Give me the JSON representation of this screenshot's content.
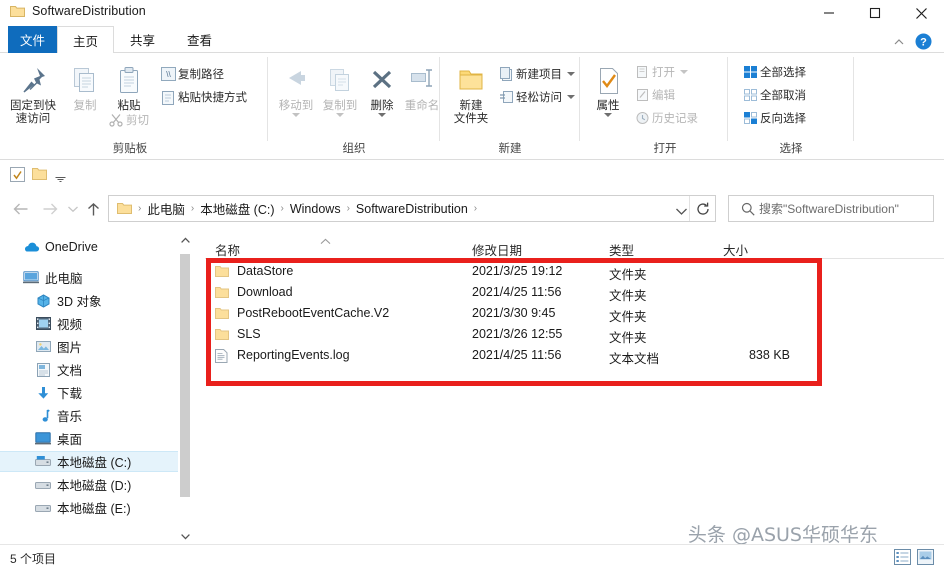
{
  "window": {
    "title": "SoftwareDistribution",
    "folder_icon": "folder-icon",
    "minimize_label": "—",
    "maximize_label": "□",
    "close_label": "✕"
  },
  "ribbon": {
    "tabs": [
      {
        "label": "文件",
        "name": "tab-file",
        "state": "file-menu"
      },
      {
        "label": "主页",
        "name": "tab-home",
        "state": "active"
      },
      {
        "label": "共享",
        "name": "tab-share",
        "state": "normal"
      },
      {
        "label": "查看",
        "name": "tab-view",
        "state": "normal"
      }
    ],
    "help_icon": "help-icon",
    "collapse_icon": "chevron-up-icon",
    "groups": [
      {
        "name": "clipboard",
        "title": "剪贴板",
        "big_buttons": [
          {
            "label_line1": "固定到快",
            "label_line2": "速访问",
            "icon": "pin-icon",
            "disabled": false
          },
          {
            "label_line1": "复制",
            "label_line2": "",
            "icon": "copy-icon",
            "disabled": true
          },
          {
            "label_line1": "粘贴",
            "label_line2": "",
            "icon": "paste-icon",
            "disabled": false
          }
        ],
        "small_buttons": [
          {
            "label": "复制路径",
            "icon": "copy-path-icon",
            "disabled": false
          },
          {
            "label": "粘贴快捷方式",
            "icon": "paste-shortcut-icon",
            "disabled": false
          },
          {
            "label": "剪切",
            "icon": "scissors-icon",
            "disabled": true
          }
        ]
      },
      {
        "name": "organize",
        "title": "组织",
        "big_buttons": [
          {
            "label_line1": "移动到",
            "label_line2": "",
            "icon": "move-to-icon",
            "disabled": true
          },
          {
            "label_line1": "复制到",
            "label_line2": "",
            "icon": "copy-to-icon",
            "disabled": true
          },
          {
            "label_line1": "删除",
            "label_line2": "",
            "icon": "delete-x-icon",
            "disabled": false
          },
          {
            "label_line1": "重命名",
            "label_line2": "",
            "icon": "rename-icon",
            "disabled": true
          }
        ],
        "small_buttons": []
      },
      {
        "name": "new",
        "title": "新建",
        "big_buttons": [
          {
            "label_line1": "新建",
            "label_line2": "文件夹",
            "icon": "new-folder-icon",
            "disabled": false
          }
        ],
        "small_buttons": [
          {
            "label": "新建项目",
            "icon": "new-item-icon",
            "disabled": false
          },
          {
            "label": "轻松访问",
            "icon": "easy-access-icon",
            "disabled": false
          }
        ]
      },
      {
        "name": "open",
        "title": "打开",
        "big_buttons": [
          {
            "label_line1": "属性",
            "label_line2": "",
            "icon": "properties-icon",
            "disabled": false
          }
        ],
        "small_buttons": [
          {
            "label": "打开",
            "icon": "open-icon",
            "disabled": true
          },
          {
            "label": "编辑",
            "icon": "edit-icon",
            "disabled": true
          },
          {
            "label": "历史记录",
            "icon": "history-icon",
            "disabled": true
          }
        ]
      },
      {
        "name": "select",
        "title": "选择",
        "big_buttons": [],
        "small_buttons": [
          {
            "label": "全部选择",
            "icon": "select-all-icon",
            "disabled": false
          },
          {
            "label": "全部取消",
            "icon": "select-none-icon",
            "disabled": false
          },
          {
            "label": "反向选择",
            "icon": "invert-selection-icon",
            "disabled": false
          }
        ]
      }
    ]
  },
  "quick_access": {
    "items": [
      {
        "name": "qa-properties",
        "icon": "properties-small-icon"
      },
      {
        "name": "qa-new-folder",
        "icon": "folder-small-icon"
      },
      {
        "name": "qa-customize",
        "icon": "chevron-down-icon"
      }
    ]
  },
  "address": {
    "back_icon": "arrow-left-icon",
    "forward_icon": "arrow-right-icon",
    "recent_icon": "chevron-down-icon",
    "up_icon": "arrow-up-icon",
    "folder_icon": "folder-icon",
    "crumbs": [
      "此电脑",
      "本地磁盘 (C:)",
      "Windows",
      "SoftwareDistribution"
    ],
    "separator": "›",
    "dropdown_icon": "chevron-down-icon",
    "refresh_icon": "refresh-icon",
    "search_icon": "search-icon",
    "search_placeholder": "搜索\"SoftwareDistribution\""
  },
  "nav_pane": {
    "items": [
      {
        "label": "OneDrive",
        "icon": "onedrive-cloud-icon",
        "indent": 0,
        "selected": false
      },
      {
        "label": "此电脑",
        "icon": "this-pc-icon",
        "indent": 0,
        "selected": false
      },
      {
        "label": "3D 对象",
        "icon": "3d-objects-icon",
        "indent": 1,
        "selected": false
      },
      {
        "label": "视频",
        "icon": "videos-icon",
        "indent": 1,
        "selected": false
      },
      {
        "label": "图片",
        "icon": "pictures-icon",
        "indent": 1,
        "selected": false
      },
      {
        "label": "文档",
        "icon": "documents-icon",
        "indent": 1,
        "selected": false
      },
      {
        "label": "下载",
        "icon": "downloads-icon",
        "indent": 1,
        "selected": false
      },
      {
        "label": "音乐",
        "icon": "music-icon",
        "indent": 1,
        "selected": false
      },
      {
        "label": "桌面",
        "icon": "desktop-icon",
        "indent": 1,
        "selected": false
      },
      {
        "label": "本地磁盘 (C:)",
        "icon": "local-disk-c-icon",
        "indent": 1,
        "selected": true
      },
      {
        "label": "本地磁盘 (D:)",
        "icon": "local-disk-icon",
        "indent": 1,
        "selected": false
      },
      {
        "label": "本地磁盘 (E:)",
        "icon": "local-disk-icon",
        "indent": 1,
        "selected": false
      }
    ],
    "scroll_up_icon": "chevron-up-icon",
    "scroll_down_icon": "chevron-down-icon"
  },
  "file_list": {
    "columns": [
      {
        "label": "名称",
        "sorted": "asc"
      },
      {
        "label": "修改日期",
        "sorted": ""
      },
      {
        "label": "类型",
        "sorted": ""
      },
      {
        "label": "大小",
        "sorted": ""
      }
    ],
    "rows": [
      {
        "name": "DataStore",
        "date": "2021/3/25 19:12",
        "type": "文件夹",
        "size": "",
        "icon": "folder-icon"
      },
      {
        "name": "Download",
        "date": "2021/4/25 11:56",
        "type": "文件夹",
        "size": "",
        "icon": "folder-icon"
      },
      {
        "name": "PostRebootEventCache.V2",
        "date": "2021/3/30 9:45",
        "type": "文件夹",
        "size": "",
        "icon": "folder-icon"
      },
      {
        "name": "SLS",
        "date": "2021/3/26 12:55",
        "type": "文件夹",
        "size": "",
        "icon": "folder-icon"
      },
      {
        "name": "ReportingEvents.log",
        "date": "2021/4/25 11:56",
        "type": "文本文档",
        "size": "838 KB",
        "icon": "text-file-icon"
      }
    ],
    "highlight_color": "#e9201c"
  },
  "status": {
    "item_count": "5 个项目",
    "view_details_icon": "details-view-icon",
    "view_thumbs_icon": "large-icons-view-icon"
  },
  "watermark": {
    "text": "头条 @ASUS华硕华东"
  },
  "colors": {
    "accent": "#0f6cbd",
    "selection": "#e5f3fb",
    "highlight": "#e9201c"
  }
}
